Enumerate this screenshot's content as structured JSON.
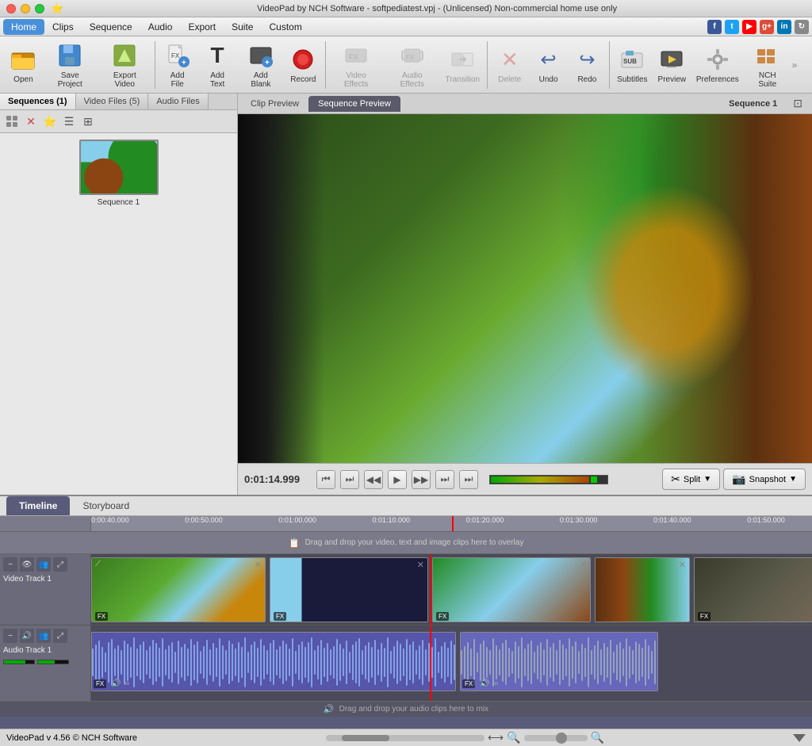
{
  "window": {
    "title": "VideoPad by NCH Software - softpediatest.vpj - (Unlicensed) Non-commercial home use only"
  },
  "menu": {
    "items": [
      "Home",
      "Clips",
      "Sequence",
      "Audio",
      "Export",
      "Suite",
      "Custom"
    ]
  },
  "toolbar": {
    "buttons": [
      {
        "id": "open",
        "label": "Open",
        "icon": "📂"
      },
      {
        "id": "save",
        "label": "Save Project",
        "icon": "💾"
      },
      {
        "id": "export",
        "label": "Export Video",
        "icon": "📤"
      },
      {
        "id": "add-file",
        "label": "Add File",
        "icon": "🎬"
      },
      {
        "id": "add-text",
        "label": "Add Text",
        "icon": "T"
      },
      {
        "id": "add-blank",
        "label": "Add Blank",
        "icon": "⬛"
      },
      {
        "id": "record",
        "label": "Record",
        "icon": "⏺"
      },
      {
        "id": "video-effects",
        "label": "Video Effects",
        "icon": "✨",
        "disabled": true
      },
      {
        "id": "audio-effects",
        "label": "Audio Effects",
        "icon": "🎵",
        "disabled": true
      },
      {
        "id": "transition",
        "label": "Transition",
        "icon": "⚡",
        "disabled": true
      },
      {
        "id": "delete",
        "label": "Delete",
        "icon": "✕",
        "disabled": true
      },
      {
        "id": "undo",
        "label": "Undo",
        "icon": "↩"
      },
      {
        "id": "redo",
        "label": "Redo",
        "icon": "↪"
      },
      {
        "id": "subtitles",
        "label": "Subtitles",
        "icon": "SUB"
      },
      {
        "id": "preview",
        "label": "Preview",
        "icon": "▶"
      },
      {
        "id": "preferences",
        "label": "Preferences",
        "icon": "🔧"
      },
      {
        "id": "nch-suite",
        "label": "NCH Suite",
        "icon": "🏠"
      }
    ]
  },
  "left_panel": {
    "tabs": [
      "Sequences (1)",
      "Video Files (5)",
      "Audio Files"
    ],
    "active_tab": "Sequences (1)",
    "sequence_name": "Sequence 1"
  },
  "preview": {
    "tabs": [
      "Clip Preview",
      "Sequence Preview"
    ],
    "active_tab": "Sequence Preview",
    "title": "Sequence 1",
    "timecode": "0:01:14.999"
  },
  "transport": {
    "buttons": [
      "⏮",
      "⏭",
      "◀◀",
      "▶",
      "▶▶",
      "⏭",
      "⏭"
    ],
    "split_label": "Split",
    "snapshot_label": "Snapshot"
  },
  "timeline": {
    "tabs": [
      "Timeline",
      "Storyboard"
    ],
    "active_tab": "Timeline",
    "overlay_hint": "Drag and drop your video, text and image clips here to overlay",
    "audio_hint": "Drag and drop your audio clips here to mix",
    "ruler_marks": [
      "0:00:40.000",
      "0:00:50.000",
      "0:01:00.000",
      "0:01:10.000",
      "0:01:20.000",
      "0:01:30.000",
      "0:01:40.000",
      "0:01:50.000"
    ],
    "video_track": {
      "name": "Video Track 1"
    },
    "audio_track": {
      "name": "Audio Track 1"
    }
  },
  "status_bar": {
    "text": "VideoPad v 4.56 © NCH Software"
  },
  "social": {
    "icons": [
      {
        "id": "facebook",
        "color": "#3b5998",
        "label": "f"
      },
      {
        "id": "twitter",
        "color": "#1da1f2",
        "label": "t"
      },
      {
        "id": "youtube",
        "color": "#ff0000",
        "label": "▶"
      },
      {
        "id": "googleplus",
        "color": "#dd4b39",
        "label": "g"
      },
      {
        "id": "linkedin",
        "color": "#0077b5",
        "label": "in"
      },
      {
        "id": "refresh",
        "color": "#888",
        "label": "↻"
      }
    ]
  }
}
